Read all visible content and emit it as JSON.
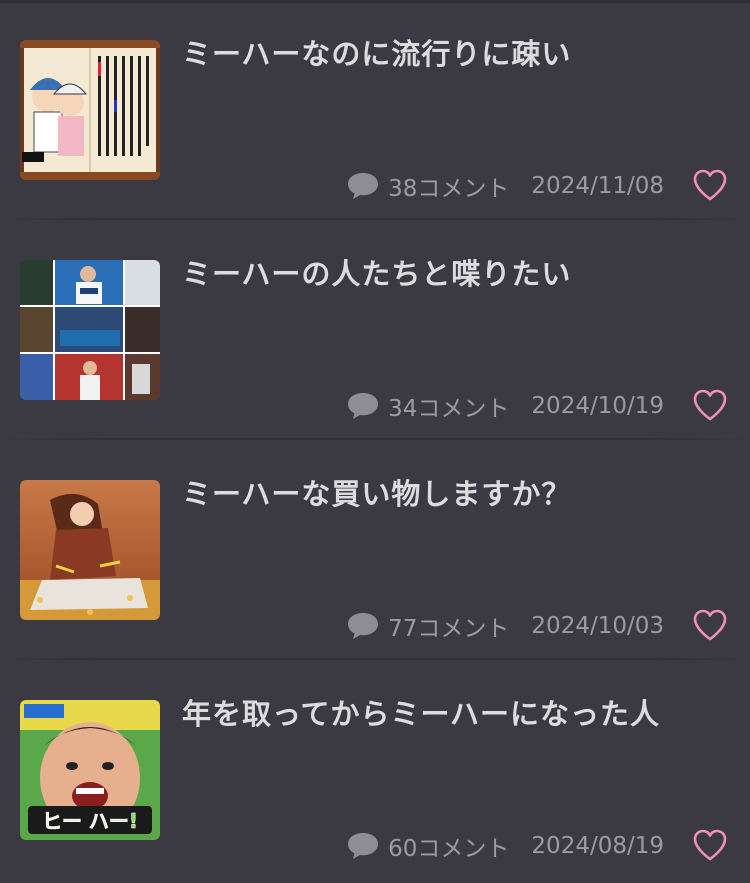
{
  "colors": {
    "background": "#3b3a43",
    "title_text": "#dcdcde",
    "meta_text": "#9c9ba3",
    "heart": "#f08fb8"
  },
  "icons": {
    "comment": "speech-bubble-icon",
    "like": "heart-outline-icon"
  },
  "topics": [
    {
      "title": "ミーハーなのに流行りに疎い",
      "comments": "38コメント",
      "date": "2024/11/08",
      "thumb_label": "book-page-illustration"
    },
    {
      "title": "ミーハーの人たちと喋りたい",
      "comments": "34コメント",
      "date": "2024/10/19",
      "thumb_label": "baseball-photo-collage"
    },
    {
      "title": "ミーハーな買い物しますか？",
      "comments": "77コメント",
      "date": "2024/10/03",
      "thumb_label": "woman-photo"
    },
    {
      "title": "年を取ってからミーハーになった人",
      "comments": "60コメント",
      "date": "2024/08/19",
      "thumb_label": "tv-show-screenshot",
      "thumb_caption": "ヒー ハー!"
    }
  ]
}
